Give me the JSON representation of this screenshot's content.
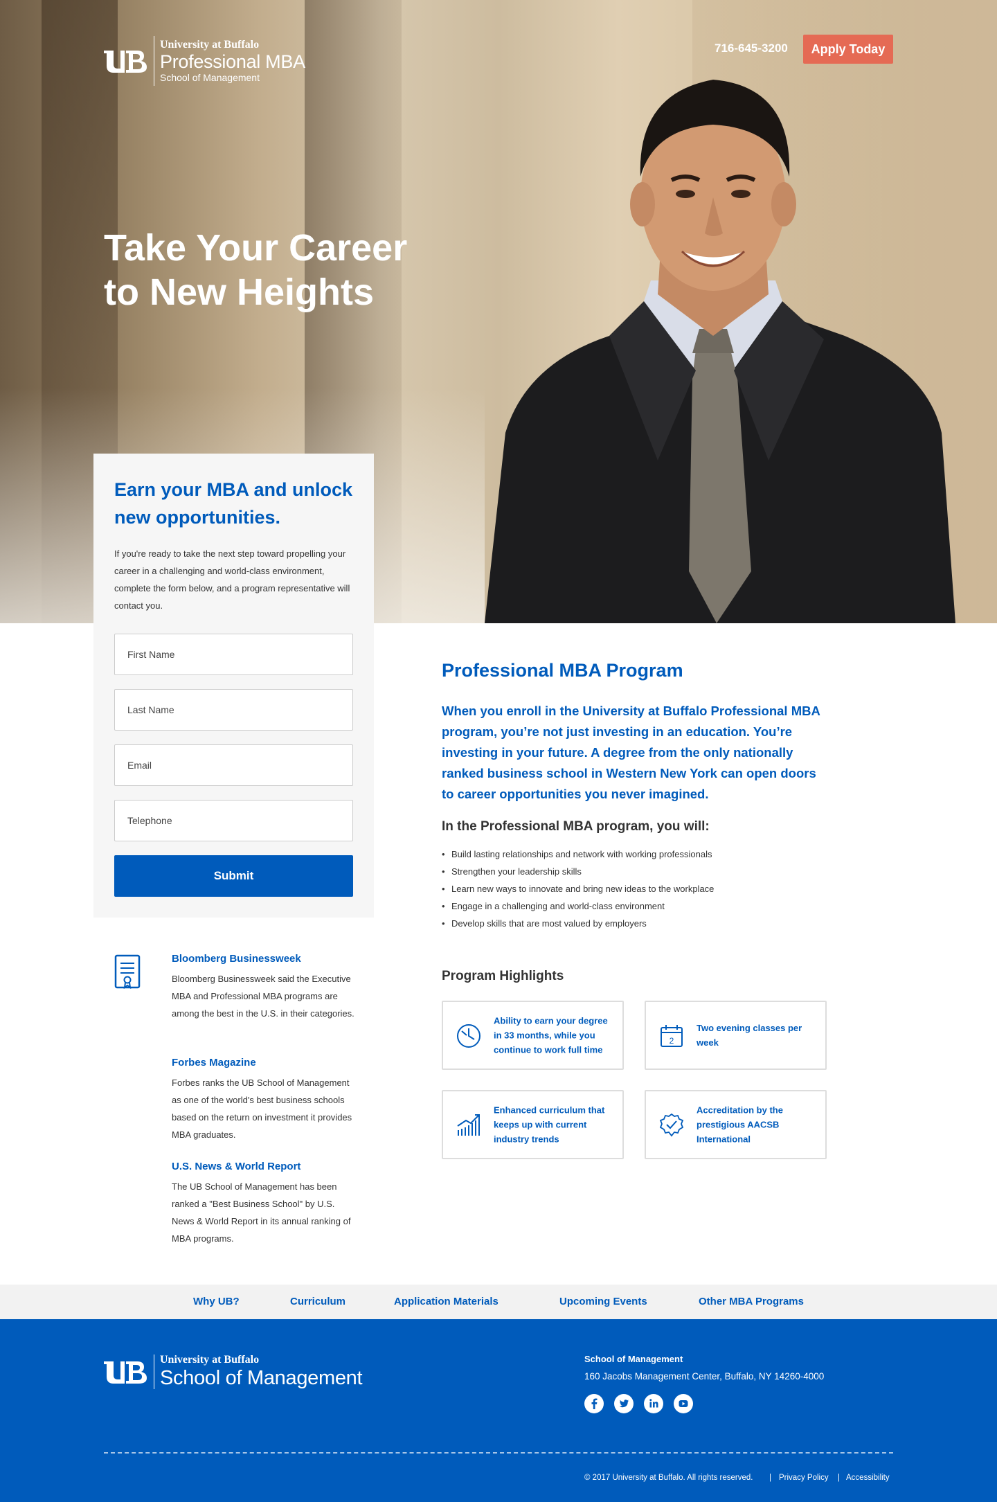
{
  "header": {
    "logo": {
      "university": "University at Buffalo",
      "program": "Professional MBA",
      "school": "School of Management"
    },
    "phone": "716-645-3200",
    "apply_label": "Apply Today"
  },
  "hero": {
    "title_line1": "Take Your Career",
    "title_line2": "to New Heights"
  },
  "form": {
    "heading": "Earn your MBA and unlock new opportunities.",
    "intro": "If you're ready to take the next step toward propelling your career in a challenging and world-class environment, complete the form below, and a program representative will contact you.",
    "first_name_placeholder": "First Name",
    "last_name_placeholder": "Last Name",
    "email_placeholder": "Email",
    "telephone_placeholder": "Telephone",
    "submit_label": "Submit"
  },
  "rankings": [
    {
      "title": "Bloomberg Businessweek",
      "text": "Bloomberg Businessweek said the Executive MBA and Professional MBA programs are among the best in the U.S. in their categories."
    },
    {
      "title": "Forbes Magazine",
      "text": "Forbes ranks the UB School of Management as one of the world's best business schools based on the return on investment it provides MBA graduates."
    },
    {
      "title": "U.S. News & World Report",
      "text": "The UB School of Management has been ranked a \"Best Business School\" by U.S. News & World Report in its annual ranking of MBA programs."
    }
  ],
  "program": {
    "title": "Professional MBA Program",
    "lead": "When you enroll in the University at Buffalo Professional MBA program, you’re not just investing in an education. You’re investing in your future. A degree from the only nationally ranked business school in Western New York can open doors to career opportunities you never imagined.",
    "will_heading": "In the Professional MBA program, you will:",
    "bullets": [
      "Build lasting relationships and network with working professionals",
      "Strengthen your leadership skills",
      "Learn new ways to innovate and bring new ideas to the workplace",
      "Engage in a challenging and world-class environment",
      "Develop skills that are most valued by employers"
    ],
    "highlights_title": "Program Highlights",
    "highlights": [
      {
        "text": "Ability to earn your degree in 33 months, while you continue to work full time",
        "icon": "clock-icon"
      },
      {
        "text": "Two evening classes per week",
        "icon": "calendar-icon",
        "calendar_number": "2"
      },
      {
        "text": "Enhanced curriculum that keeps up with current industry trends",
        "icon": "trend-chart-icon"
      },
      {
        "text": "Accreditation by the prestigious AACSB International",
        "icon": "check-badge-icon"
      }
    ]
  },
  "subnav": [
    "Why UB?",
    "Curriculum",
    "Application Materials",
    "Upcoming Events",
    "Other MBA Programs"
  ],
  "footer": {
    "logo": {
      "university": "University at Buffalo",
      "school": "School of Management"
    },
    "school_name": "School of Management",
    "address": "160 Jacobs Management Center, Buffalo, NY 14260-4000",
    "social": [
      "facebook-icon",
      "twitter-icon",
      "linkedin-icon",
      "youtube-icon"
    ],
    "copyright": "© 2017 University at Buffalo. All rights reserved.",
    "separator": "|",
    "privacy": "Privacy Policy",
    "accessibility": "Accessibility"
  },
  "colors": {
    "brand_blue": "#005bbb",
    "apply_orange": "#e56a54",
    "panel_gray": "#f6f6f6"
  }
}
